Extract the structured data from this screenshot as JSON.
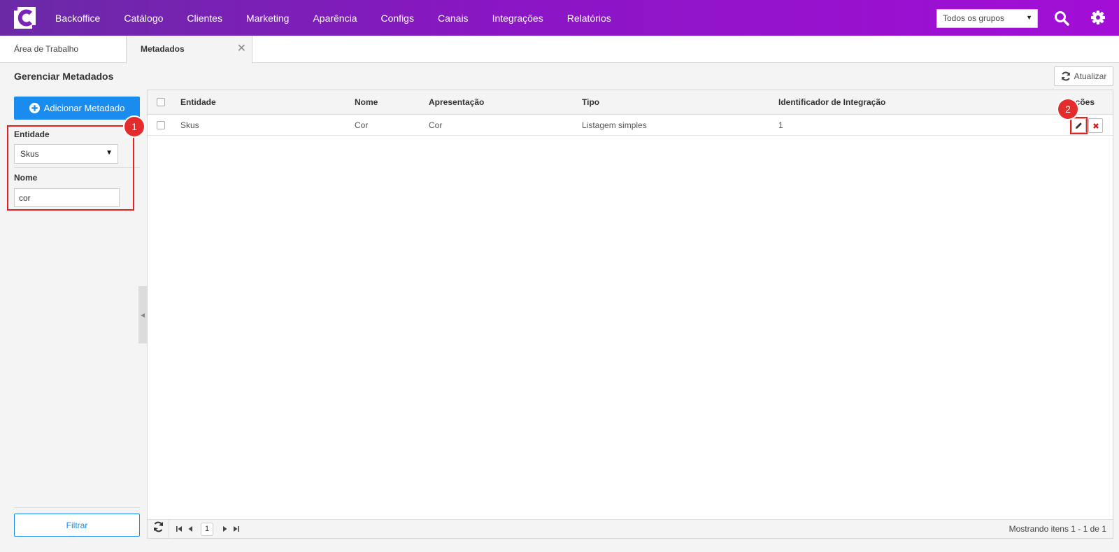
{
  "nav": {
    "items": [
      "Backoffice",
      "Catálogo",
      "Clientes",
      "Marketing",
      "Aparência",
      "Configs",
      "Canais",
      "Integrações",
      "Relatórios"
    ],
    "group_select_value": "Todos os grupos"
  },
  "tabs": [
    {
      "label": "Área de Trabalho"
    },
    {
      "label": "Metadados"
    }
  ],
  "page": {
    "title": "Gerenciar Metadados",
    "refresh_label": "Atualizar"
  },
  "sidebar": {
    "add_label": "Adicionar Metadado",
    "entity_label": "Entidade",
    "entity_value": "Skus",
    "name_label": "Nome",
    "name_value": "cor",
    "filter_label": "Filtrar"
  },
  "annotations": [
    "1",
    "2"
  ],
  "table": {
    "columns": [
      "Entidade",
      "Nome",
      "Apresentação",
      "Tipo",
      "Identificador de Integração",
      "Ações"
    ],
    "rows": [
      [
        "Skus",
        "Cor",
        "Cor",
        "Listagem simples",
        "1"
      ]
    ]
  },
  "pager": {
    "page": "1",
    "info": "Mostrando itens 1 - 1 de 1"
  },
  "colors": {
    "nav_gradient_start": "#6a2aa6",
    "nav_gradient_end": "#a20ed6",
    "primary": "#1a8cf0",
    "highlight": "#e32222"
  }
}
